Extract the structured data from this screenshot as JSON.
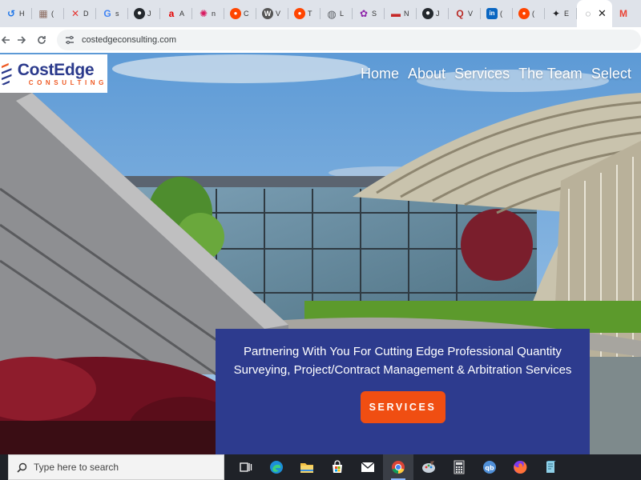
{
  "browser": {
    "tabs": [
      {
        "title": "H",
        "icon": "history-icon",
        "color": "#1a73e8",
        "glyph": "↺"
      },
      {
        "title": "(",
        "icon": "gallery-icon",
        "color": "#8d6e63",
        "glyph": "▦"
      },
      {
        "title": "D",
        "icon": "x-icon",
        "color": "#e53935",
        "glyph": "✕"
      },
      {
        "title": "s",
        "icon": "google-icon",
        "color": "#4285f4",
        "glyph": "G"
      },
      {
        "title": "J",
        "icon": "github-icon",
        "color": "#24292e",
        "glyph": "●"
      },
      {
        "title": "A",
        "icon": "airtel-icon",
        "color": "#e40000",
        "glyph": "a"
      },
      {
        "title": "n",
        "icon": "react-icon",
        "color": "#d81b60",
        "glyph": "✺"
      },
      {
        "title": "C",
        "icon": "reddit-icon",
        "color": "#ff4500",
        "glyph": "●"
      },
      {
        "title": "V",
        "icon": "wordpress-icon",
        "color": "#555555",
        "glyph": "W"
      },
      {
        "title": "T",
        "icon": "reddit-icon",
        "color": "#ff4500",
        "glyph": "●"
      },
      {
        "title": "L",
        "icon": "globe-icon",
        "color": "#5f6368",
        "glyph": "◍"
      },
      {
        "title": "S",
        "icon": "app-icon",
        "color": "#8e24aa",
        "glyph": "✿"
      },
      {
        "title": "N",
        "icon": "flag-icon",
        "color": "#c62828",
        "glyph": "▬"
      },
      {
        "title": "J",
        "icon": "github-icon",
        "color": "#24292e",
        "glyph": "●"
      },
      {
        "title": "V",
        "icon": "quora-icon",
        "color": "#b92b27",
        "glyph": "Q"
      },
      {
        "title": "(",
        "icon": "linkedin-icon",
        "color": "#0a66c2",
        "glyph": "in"
      },
      {
        "title": "(",
        "icon": "reddit-icon",
        "color": "#ff4500",
        "glyph": "●"
      },
      {
        "title": "E",
        "icon": "compass-icon",
        "color": "#202124",
        "glyph": "✦"
      },
      {
        "title": "C",
        "icon": "generic-tab-icon",
        "color": "#5f6368",
        "glyph": "◌"
      }
    ],
    "close_glyph": "✕",
    "gmail_glyph": "M",
    "address": "costedgeconsulting.com"
  },
  "site": {
    "logo": {
      "name": "CostEdge",
      "tagline": "CONSULTING"
    },
    "nav": [
      "Home",
      "About",
      "Services",
      "The Team",
      "Select"
    ],
    "cta": {
      "text": "Partnering With You For Cutting Edge Professional Quantity Surveying, Project/Contract Management & Arbitration Services",
      "button": "SERVICES"
    }
  },
  "taskbar": {
    "search_placeholder": "Type here to search",
    "apps": [
      "task-view-icon",
      "edge-icon",
      "file-explorer-icon",
      "store-icon",
      "mail-icon",
      "chrome-icon",
      "paint-icon",
      "calculator-icon",
      "qbittorrent-icon",
      "firefox-icon",
      "notepad-icon"
    ]
  },
  "colors": {
    "brand_blue": "#2d3b8e",
    "brand_orange": "#f04e12"
  }
}
